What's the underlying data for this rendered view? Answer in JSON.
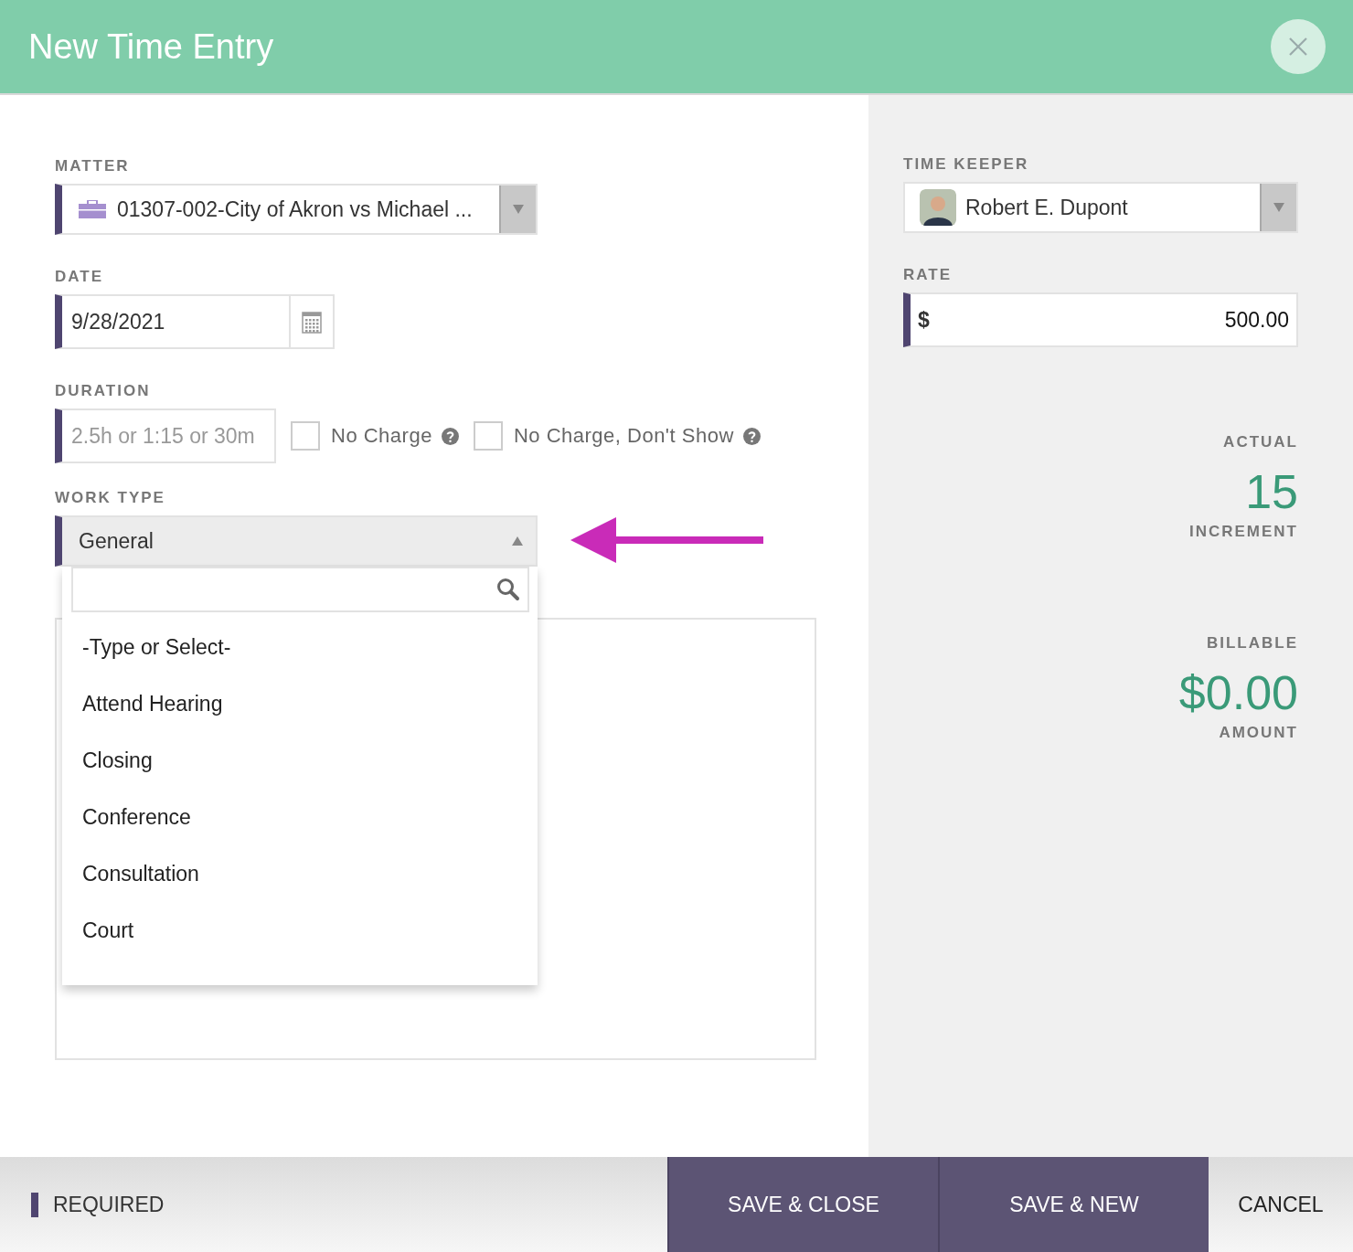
{
  "dialog": {
    "title": "New Time Entry"
  },
  "matter": {
    "label": "MATTER",
    "value": "01307-002-City of Akron vs Michael ...",
    "required": true
  },
  "date": {
    "label": "DATE",
    "value": "9/28/2021",
    "required": true
  },
  "duration": {
    "label": "DURATION",
    "placeholder": "2.5h or 1:15 or 30m",
    "required": true
  },
  "checkboxes": [
    {
      "label": "No Charge",
      "checked": false
    },
    {
      "label": "No Charge, Don't Show",
      "checked": false
    }
  ],
  "work_type": {
    "label": "WORK TYPE",
    "value": "General",
    "expanded": true,
    "required": true,
    "options": [
      {
        "label": "-Type or Select-"
      },
      {
        "label": "Attend Hearing"
      },
      {
        "label": "Closing"
      },
      {
        "label": "Conference"
      },
      {
        "label": "Consultation"
      },
      {
        "label": "Court"
      }
    ]
  },
  "time_keeper": {
    "label": "TIME KEEPER",
    "value": "Robert E. Dupont",
    "required": false
  },
  "rate": {
    "label": "RATE",
    "currency": "$",
    "value": "500.00",
    "required": true
  },
  "actual": {
    "label": "ACTUAL",
    "value": "15",
    "caption": "INCREMENT"
  },
  "billable": {
    "label": "BILLABLE",
    "value": "$0.00",
    "caption": "AMOUNT"
  },
  "footer": {
    "required_note": "REQUIRED",
    "buttons": [
      {
        "label": "SAVE & CLOSE",
        "kind": "primary"
      },
      {
        "label": "SAVE & NEW",
        "kind": "primary"
      },
      {
        "label": "CANCEL",
        "kind": "plain"
      }
    ]
  }
}
